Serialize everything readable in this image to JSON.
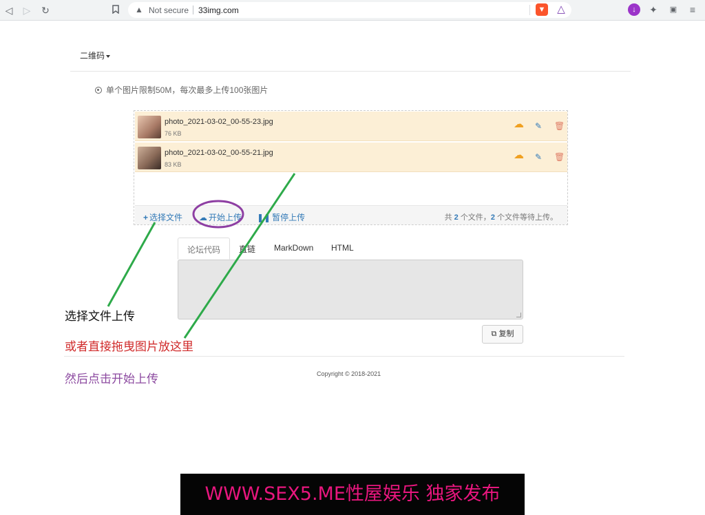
{
  "browser": {
    "security_label": "Not secure",
    "url": "33img.com"
  },
  "page": {
    "menu_label": "二维码",
    "limit_notice": "单个图片限制50M，每次最多上传100张图片",
    "files": [
      {
        "name": "photo_2021-03-02_00-55-23.jpg",
        "size": "76 KB"
      },
      {
        "name": "photo_2021-03-02_00-55-21.jpg",
        "size": "83 KB"
      }
    ],
    "actions": {
      "choose_label": "选择文件",
      "start_label": "开始上传",
      "pause_label": "暂停上传"
    },
    "stats": {
      "prefix": "共",
      "total": "2",
      "mid": "个文件，",
      "waiting": "2",
      "suffix": "个文件等待上传。"
    },
    "tabs": [
      "论坛代码",
      "直链",
      "MarkDown",
      "HTML"
    ],
    "copy_label": "复制",
    "copyright": "Copyright © 2018-2021"
  },
  "annotations": {
    "step1": "选择文件上传",
    "step2": "或者直接拖曳图片放这里",
    "step3": "然后点击开始上传",
    "colors": {
      "step1": "#111111",
      "step2": "#d02a2a",
      "step3": "#8c4aa0",
      "lines": "#2eaa4a",
      "circle": "#8e3fa3"
    }
  },
  "banner": {
    "text": "WWW.SEX5.ME性屋娱乐 独家发布",
    "color": "#e8167e"
  },
  "icons": [
    "back-icon",
    "forward-icon",
    "reload-icon",
    "bookmark-icon",
    "warning-icon",
    "brave-shield-icon",
    "brave-rewards-icon",
    "download-icon",
    "extensions-icon",
    "wallet-icon",
    "upload-cloud-icon",
    "edit-icon",
    "trash-icon",
    "plus-icon",
    "pause-icon",
    "copy-icon"
  ]
}
